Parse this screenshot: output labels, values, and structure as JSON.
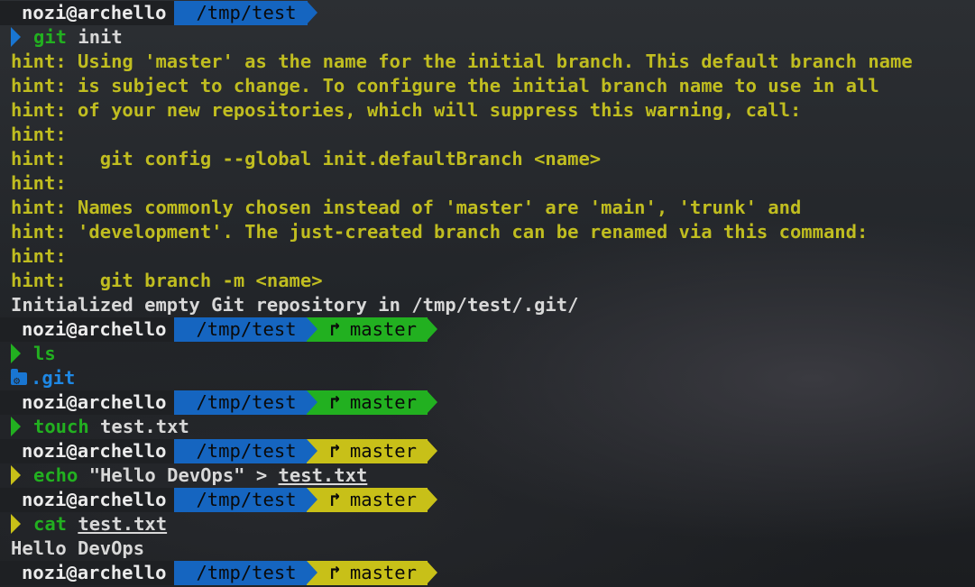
{
  "colors": {
    "path_bg": "#1565c0",
    "git_clean_bg": "#22b020",
    "git_dirty_bg": "#c8c018",
    "prompt_ok": "#1976d2",
    "prompt_green": "#22b020",
    "prompt_yellow": "#c8c018",
    "hint_text": "#c0bd20",
    "cmd_green": "#22b020",
    "dir_blue": "#1e88e5"
  },
  "icons": {
    "branch": "git-branch-icon",
    "folder": "git-folder-icon",
    "prompt": "chevron-right-icon"
  },
  "lines": [
    {
      "kind": "prompt",
      "user": "nozi@archello",
      "path": "/tmp/test"
    },
    {
      "kind": "command",
      "chevron": "blue",
      "cmd": "git",
      "args": " init"
    },
    {
      "kind": "hint",
      "text": "hint: Using 'master' as the name for the initial branch. This default branch name"
    },
    {
      "kind": "hint",
      "text": "hint: is subject to change. To configure the initial branch name to use in all"
    },
    {
      "kind": "hint",
      "text": "hint: of your new repositories, which will suppress this warning, call:"
    },
    {
      "kind": "hint",
      "text": "hint:"
    },
    {
      "kind": "hint",
      "text": "hint:   git config --global init.defaultBranch <name>"
    },
    {
      "kind": "hint",
      "text": "hint:"
    },
    {
      "kind": "hint",
      "text": "hint: Names commonly chosen instead of 'master' are 'main', 'trunk' and"
    },
    {
      "kind": "hint",
      "text": "hint: 'development'. The just-created branch can be renamed via this command:"
    },
    {
      "kind": "hint",
      "text": "hint:"
    },
    {
      "kind": "hint",
      "text": "hint:   git branch -m <name>"
    },
    {
      "kind": "output",
      "text": "Initialized empty Git repository in /tmp/test/.git/"
    },
    {
      "kind": "prompt",
      "user": "nozi@archello",
      "path": "/tmp/test",
      "branch": "master",
      "git_state": "clean"
    },
    {
      "kind": "command",
      "chevron": "green",
      "cmd": "ls",
      "args": ""
    },
    {
      "kind": "dir",
      "text": ".git"
    },
    {
      "kind": "prompt",
      "user": "nozi@archello",
      "path": "/tmp/test",
      "branch": "master",
      "git_state": "clean"
    },
    {
      "kind": "command",
      "chevron": "green",
      "cmd": "touch",
      "args": " test.txt"
    },
    {
      "kind": "prompt",
      "user": "nozi@archello",
      "path": "/tmp/test",
      "branch": "master",
      "git_state": "dirty"
    },
    {
      "kind": "command",
      "chevron": "yellow",
      "cmd": "echo",
      "args": " \"Hello DevOps\" > ",
      "file": "test.txt"
    },
    {
      "kind": "prompt",
      "user": "nozi@archello",
      "path": "/tmp/test",
      "branch": "master",
      "git_state": "dirty"
    },
    {
      "kind": "command",
      "chevron": "yellow",
      "cmd": "cat",
      "args": " ",
      "file": "test.txt"
    },
    {
      "kind": "output",
      "text": "Hello DevOps"
    },
    {
      "kind": "prompt",
      "user": "nozi@archello",
      "path": "/tmp/test",
      "branch": "master",
      "git_state": "dirty"
    }
  ]
}
